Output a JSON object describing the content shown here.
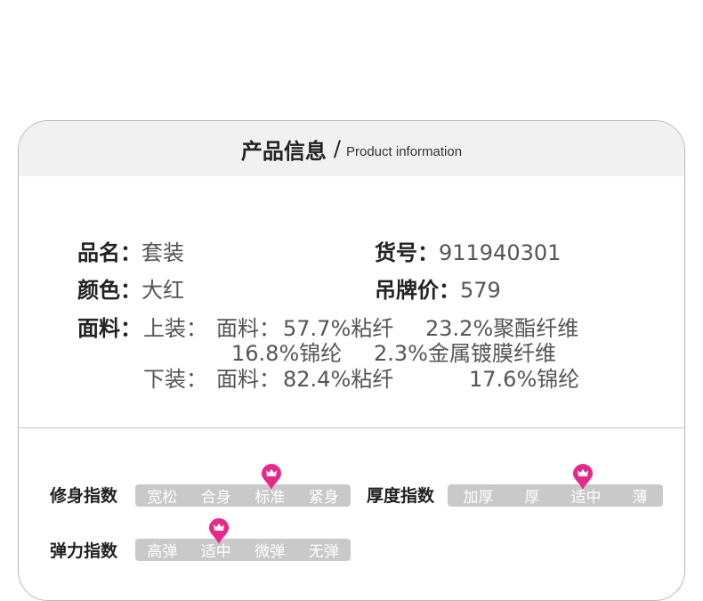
{
  "header": {
    "title_cn": "产品信息",
    "separator": "/",
    "title_en": "Product information"
  },
  "info": {
    "name_label": "品名：",
    "name_value": "套装",
    "sku_label": "货号：",
    "sku_value": "911940301",
    "color_label": "颜色：",
    "color_value": "大红",
    "price_label": "吊牌价：",
    "price_value": "579",
    "fabric_label": "面料：",
    "top_label": "上装：",
    "top_fabric_label": "面料：",
    "top_comp_1": "57.7%粘纤",
    "top_comp_2": "23.2%聚酯纤维",
    "top_comp_3": "16.8%锦纶",
    "top_comp_4": "2.3%金属镀膜纤维",
    "bottom_label": "下装：",
    "bottom_fabric_label": "面料：",
    "bottom_comp_1": "82.4%粘纤",
    "bottom_comp_2": "17.6%锦纶"
  },
  "indices": {
    "fit": {
      "label": "修身指数",
      "options": [
        "宽松",
        "合身",
        "标准",
        "紧身"
      ],
      "selected": "标准"
    },
    "thickness": {
      "label": "厚度指数",
      "options": [
        "加厚",
        "厚",
        "适中",
        "薄"
      ],
      "selected": "适中"
    },
    "elasticity": {
      "label": "弹力指数",
      "options": [
        "高弹",
        "适中",
        "微弹",
        "无弹"
      ],
      "selected": "适中"
    }
  },
  "colors": {
    "pin": "#e8278a",
    "scale_bg": "#c9c9c9",
    "header_bg": "#f1f1f1"
  },
  "icons": {
    "marker": "map-pin-crown-icon"
  }
}
